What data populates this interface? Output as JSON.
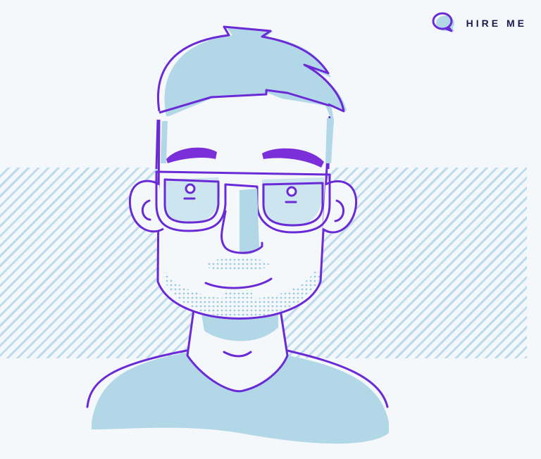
{
  "hire_me": {
    "label": "HIRE ME",
    "icon": "speech-bubble-icon"
  },
  "colors": {
    "background": "#f5f8fb",
    "stripe": "#bcdcee",
    "fill": "#b2d8e8",
    "outline": "#6a2bd6",
    "brow": "#7b2fd9",
    "label": "#1a1a4d"
  }
}
